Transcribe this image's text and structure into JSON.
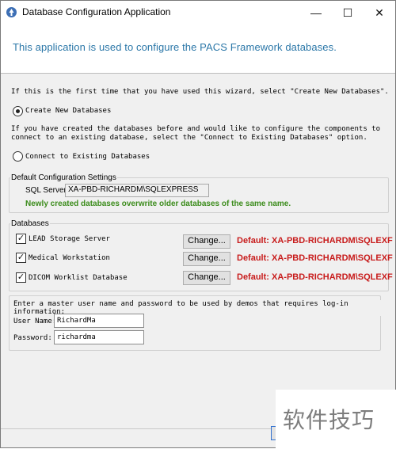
{
  "window": {
    "title": "Database Configuration Application",
    "minimize_glyph": "—",
    "maximize_glyph": "☐",
    "close_glyph": "✕"
  },
  "header": {
    "text": "This application is used to configure the PACS Framework databases."
  },
  "intro": {
    "first_time": "If this is the first time that you have used this wizard, select \"Create New Databases\".",
    "option_create": "Create New Databases",
    "already_created_line1": "If you have created the databases before and would like to configure the components to",
    "already_created_line2": "connect to an existing database, select the \"Connect to Existing Databases\" option.",
    "option_connect": "Connect to Existing Databases",
    "selected_option": "create"
  },
  "defaults": {
    "group_label": "Default Configuration Settings",
    "sql_label": "SQL Server:",
    "sql_value": "XA-PBD-RICHARDM\\SQLEXPRESS",
    "note": "Newly created databases overwrite older databases of the same name."
  },
  "databases": {
    "group_label": "Databases",
    "items": [
      {
        "label": "LEAD Storage Server",
        "checked": true,
        "button": "Change...",
        "default": "Default: XA-PBD-RICHARDM\\SQLEXF"
      },
      {
        "label": "Medical Workstation",
        "checked": true,
        "button": "Change...",
        "default": "Default: XA-PBD-RICHARDM\\SQLEXF"
      },
      {
        "label": "DICOM Worklist Database",
        "checked": true,
        "button": "Change...",
        "default": "Default: XA-PBD-RICHARDM\\SQLEXF"
      }
    ]
  },
  "credentials": {
    "prompt": "Enter a master user name and password to be used by demos that requires log-in information:",
    "user_label": "User Name:",
    "user_value": "RichardMa",
    "password_label": "Password:",
    "password_value": "richardma"
  },
  "watermark": {
    "text": "软件技巧"
  },
  "colors": {
    "header_text": "#2b77a8",
    "default_text": "#c81c1c",
    "note_text": "#3c8c1c"
  }
}
